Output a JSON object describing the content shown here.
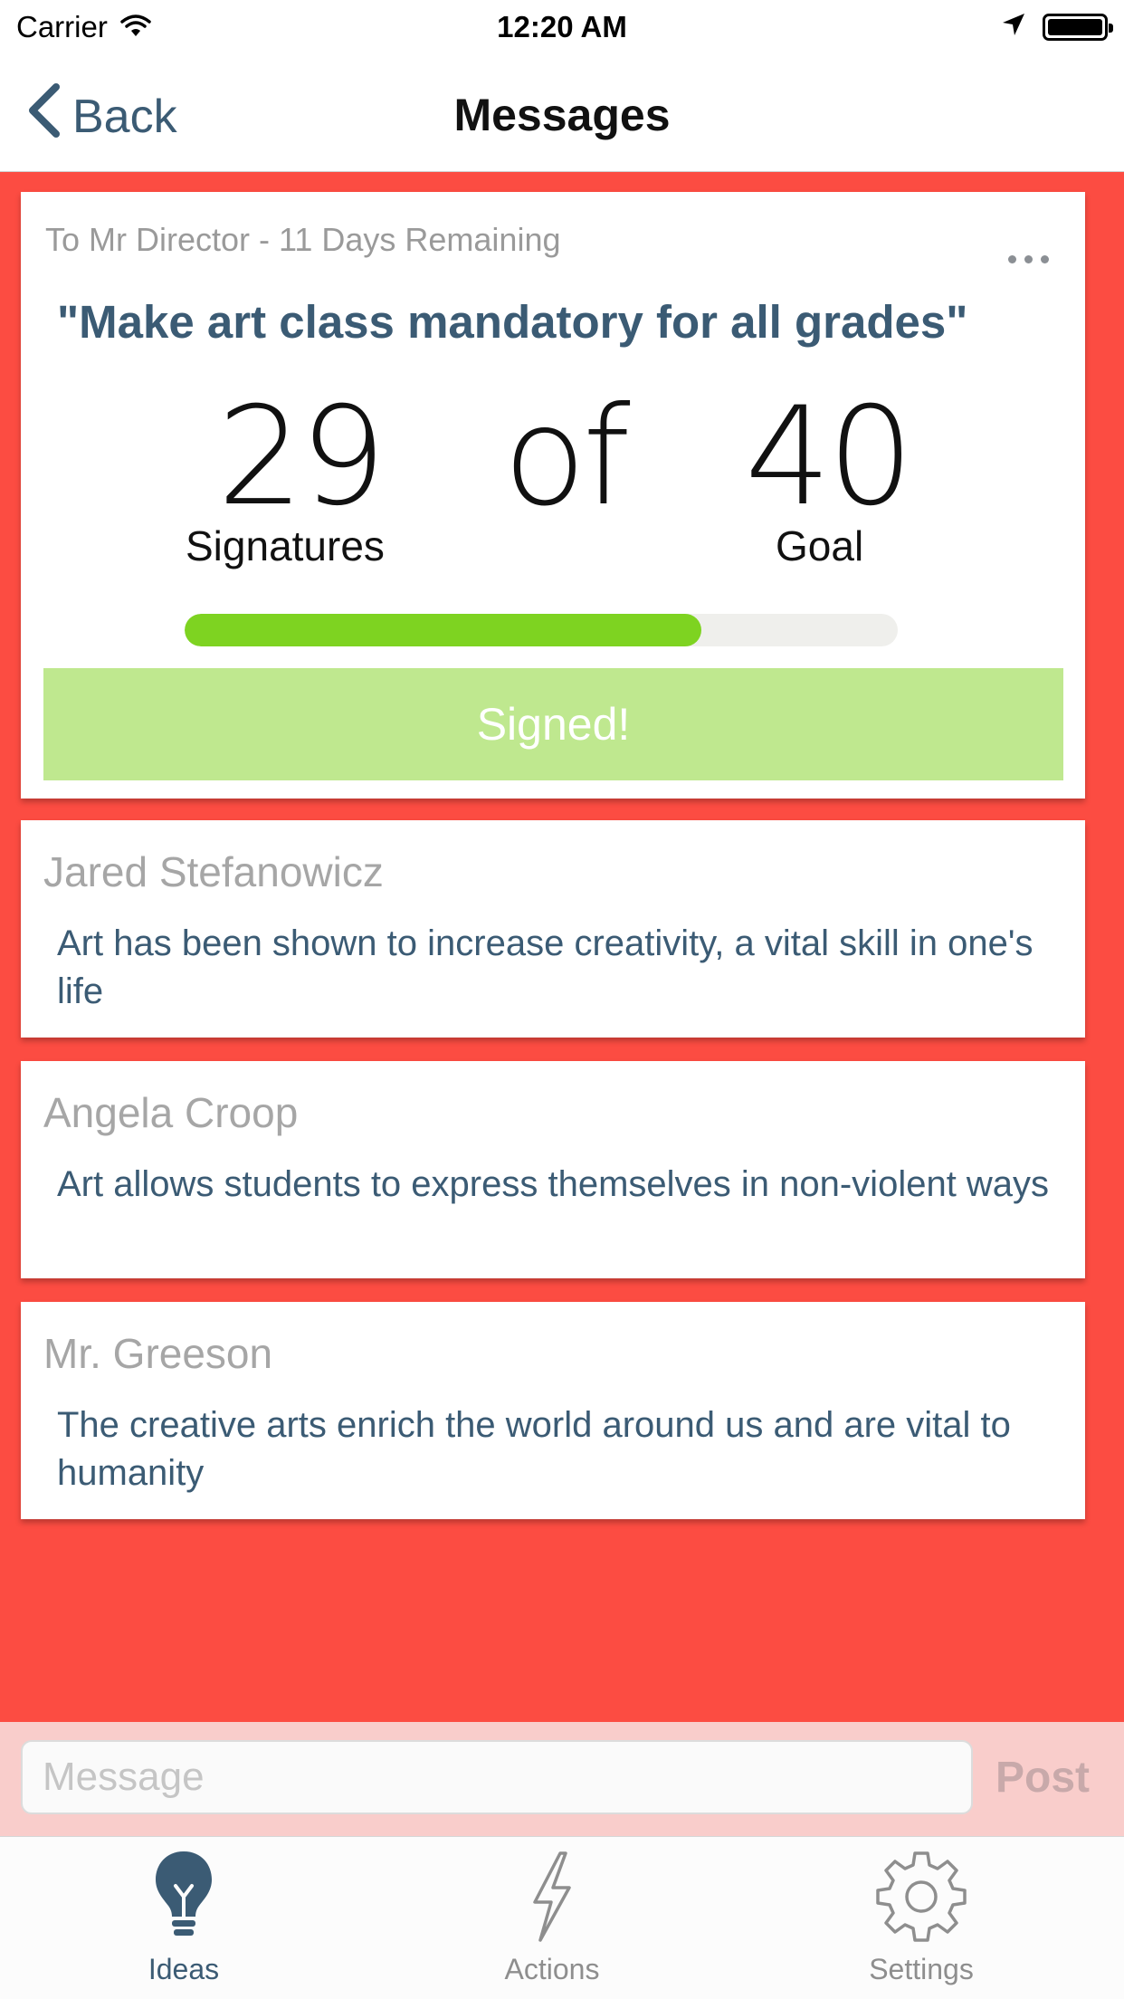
{
  "status_bar": {
    "carrier": "Carrier",
    "time": "12:20 AM"
  },
  "nav": {
    "back_label": "Back",
    "title": "Messages"
  },
  "petition": {
    "meta": "To Mr Director - 11 Days Remaining",
    "title": "\"Make art class mandatory for all grades\"",
    "signatures": "29",
    "signatures_label": "Signatures",
    "of_label": "of",
    "goal": "40",
    "goal_label": "Goal",
    "progress_fraction": 0.725,
    "signed_label": "Signed!"
  },
  "comments": [
    {
      "author": "Jared Stefanowicz",
      "text": "Art has been shown to increase creativity, a vital skill in one's life"
    },
    {
      "author": "Angela Croop",
      "text": "Art allows students to express themselves in non-violent ways"
    },
    {
      "author": "Mr. Greeson",
      "text": "The creative arts enrich the world around us and are vital to humanity"
    }
  ],
  "composer": {
    "placeholder": "Message",
    "post_label": "Post"
  },
  "tabs": [
    {
      "label": "Ideas",
      "icon": "lightbulb-icon",
      "active": true
    },
    {
      "label": "Actions",
      "icon": "lightning-bolt-icon",
      "active": false
    },
    {
      "label": "Settings",
      "icon": "gear-icon",
      "active": false
    }
  ],
  "colors": {
    "background_red": "#fc4c42",
    "accent_blue": "#3b5b74",
    "progress_green": "#7ed321",
    "signed_green": "#bfe88f",
    "composer_pink": "#f9cdcb"
  }
}
